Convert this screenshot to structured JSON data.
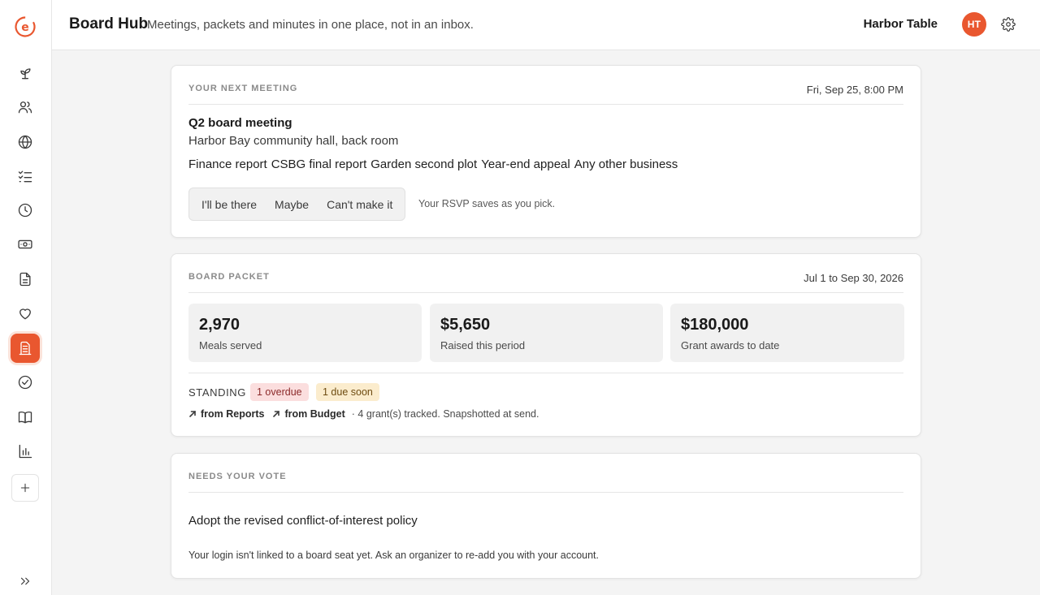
{
  "app": {
    "logo_letter": "e",
    "brand_color": "#e9572f"
  },
  "header": {
    "title": "Board Hub",
    "subtitle": "Meetings, packets and minutes in one place, not in an inbox.",
    "org_name": "Harbor Table",
    "avatar_initials": "HT"
  },
  "sidebar": {
    "items": [
      {
        "icon": "sprout-icon"
      },
      {
        "icon": "users-icon"
      },
      {
        "icon": "globe-icon"
      },
      {
        "icon": "checklist-icon"
      },
      {
        "icon": "clock-icon"
      },
      {
        "icon": "banknote-icon"
      },
      {
        "icon": "document-icon"
      },
      {
        "icon": "heart-icon"
      },
      {
        "icon": "board-icon",
        "active": true
      },
      {
        "icon": "check-circle-icon"
      },
      {
        "icon": "book-icon"
      },
      {
        "icon": "bar-chart-icon"
      },
      {
        "icon": "plus-icon"
      }
    ]
  },
  "next_meeting": {
    "label": "YOUR NEXT MEETING",
    "datetime": "Fri, Sep 25, 8:00 PM",
    "title": "Q2 board meeting",
    "location": "Harbor Bay community hall, back room",
    "agenda": [
      "Finance report",
      "CSBG final report",
      "Garden second plot",
      "Year-end appeal",
      "Any other business"
    ],
    "rsvp_options": [
      "I'll be there",
      "Maybe",
      "Can't make it"
    ],
    "rsvp_note": "Your RSVP saves as you pick."
  },
  "board_packet": {
    "label": "BOARD PACKET",
    "period": "Jul 1 to Sep 30, 2026",
    "stats": [
      {
        "value": "2,970",
        "label": "Meals served"
      },
      {
        "value": "$5,650",
        "label": "Raised this period"
      },
      {
        "value": "$180,000",
        "label": "Grant awards to date"
      }
    ],
    "standing_label": "STANDING",
    "badges": {
      "overdue": "1 overdue",
      "due_soon": "1 due soon"
    },
    "links": [
      "from Reports",
      "from Budget"
    ],
    "links_note": "· 4 grant(s) tracked. Snapshotted at send."
  },
  "vote": {
    "label": "NEEDS YOUR VOTE",
    "item": "Adopt the revised conflict-of-interest policy",
    "note": "Your login isn't linked to a board seat yet. Ask an organizer to re-add you with your account."
  }
}
